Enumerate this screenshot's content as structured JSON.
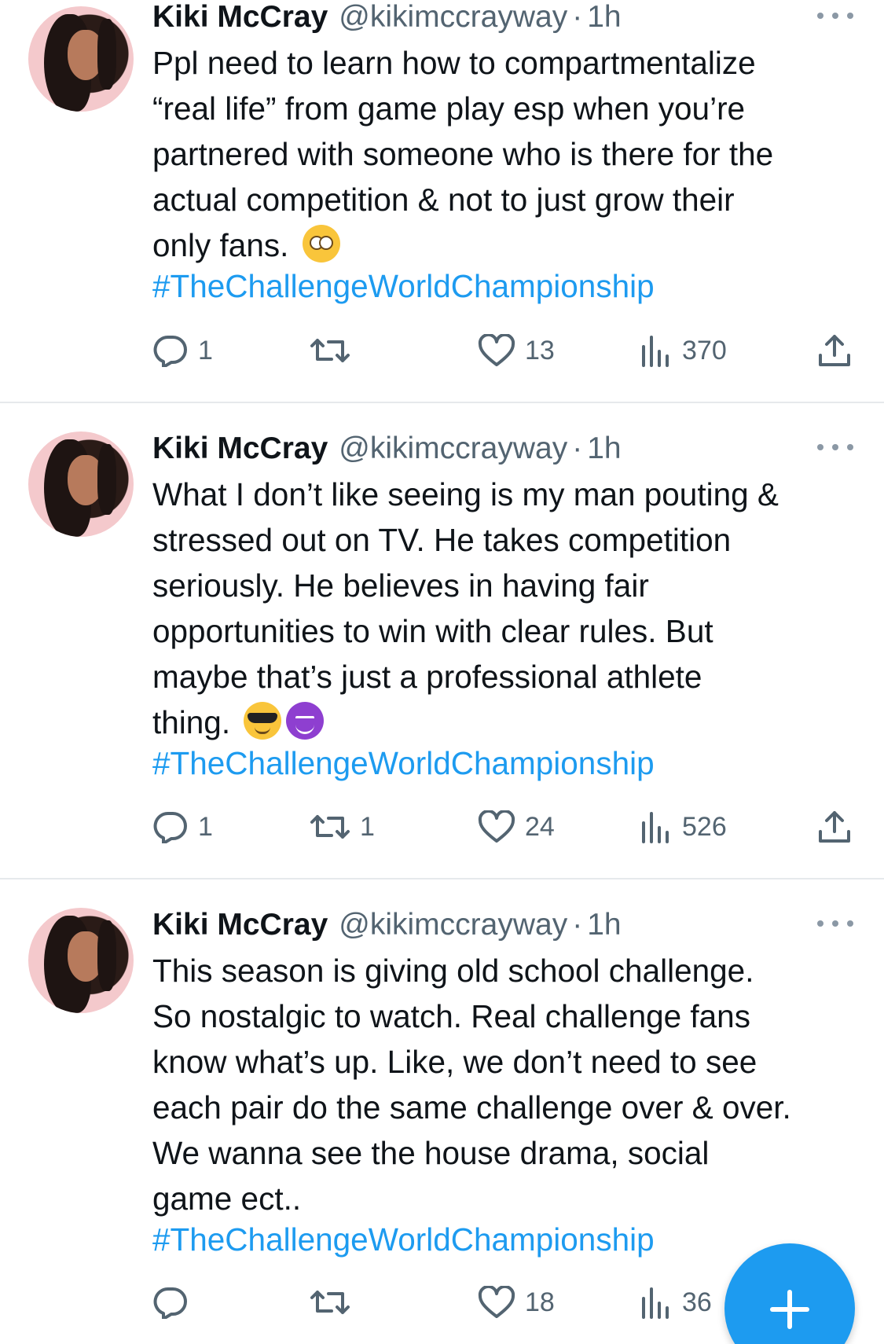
{
  "tweets": [
    {
      "author": {
        "name": "Kiki McCray",
        "handle": "@kikimccrayway",
        "time": "1h"
      },
      "text_lines": [
        "Ppl need to learn how to compartmentalize",
        "“real life” from game play esp when you’re",
        "partnered with someone who is there for the",
        "actual competition & not to just grow their",
        "only fans."
      ],
      "emojis": [
        "face-with-rolling-eyes"
      ],
      "hashtag": "#TheChallengeWorldChampionship",
      "actions": {
        "replies": "1",
        "retweets": "",
        "likes": "13",
        "views": "370"
      }
    },
    {
      "author": {
        "name": "Kiki McCray",
        "handle": "@kikimccrayway",
        "time": "1h"
      },
      "text_lines": [
        "What I don’t like seeing is my man pouting &",
        "stressed out on TV. He takes competition",
        "seriously. He believes in having fair",
        "opportunities to win with clear rules. But",
        "maybe that’s just a professional athlete",
        "thing."
      ],
      "emojis": [
        "smiling-face-with-sunglasses",
        "smiling-face-with-horns"
      ],
      "hashtag": "#TheChallengeWorldChampionship",
      "actions": {
        "replies": "1",
        "retweets": "1",
        "likes": "24",
        "views": "526"
      }
    },
    {
      "author": {
        "name": "Kiki McCray",
        "handle": "@kikimccrayway",
        "time": "1h"
      },
      "text_lines": [
        "This season is giving old school challenge.",
        "So nostalgic to watch. Real challenge fans",
        "know what’s up. Like, we don’t need to see",
        "each pair do the same challenge over & over.",
        "We wanna see the house drama, social",
        "game ect.."
      ],
      "emojis": [],
      "hashtag": "#TheChallengeWorldChampionship",
      "actions": {
        "replies": "",
        "retweets": "",
        "likes": "18",
        "views": "36"
      }
    }
  ],
  "separator": "·",
  "icons": {
    "reply": "reply-icon",
    "retweet": "retweet-icon",
    "like": "heart-icon",
    "views": "views-icon",
    "share": "share-icon",
    "more": "more-icon",
    "compose": "compose-plus-icon"
  },
  "colors": {
    "link": "#1d9bf0",
    "secondary_text": "#536471",
    "fab": "#1d9bf0"
  }
}
